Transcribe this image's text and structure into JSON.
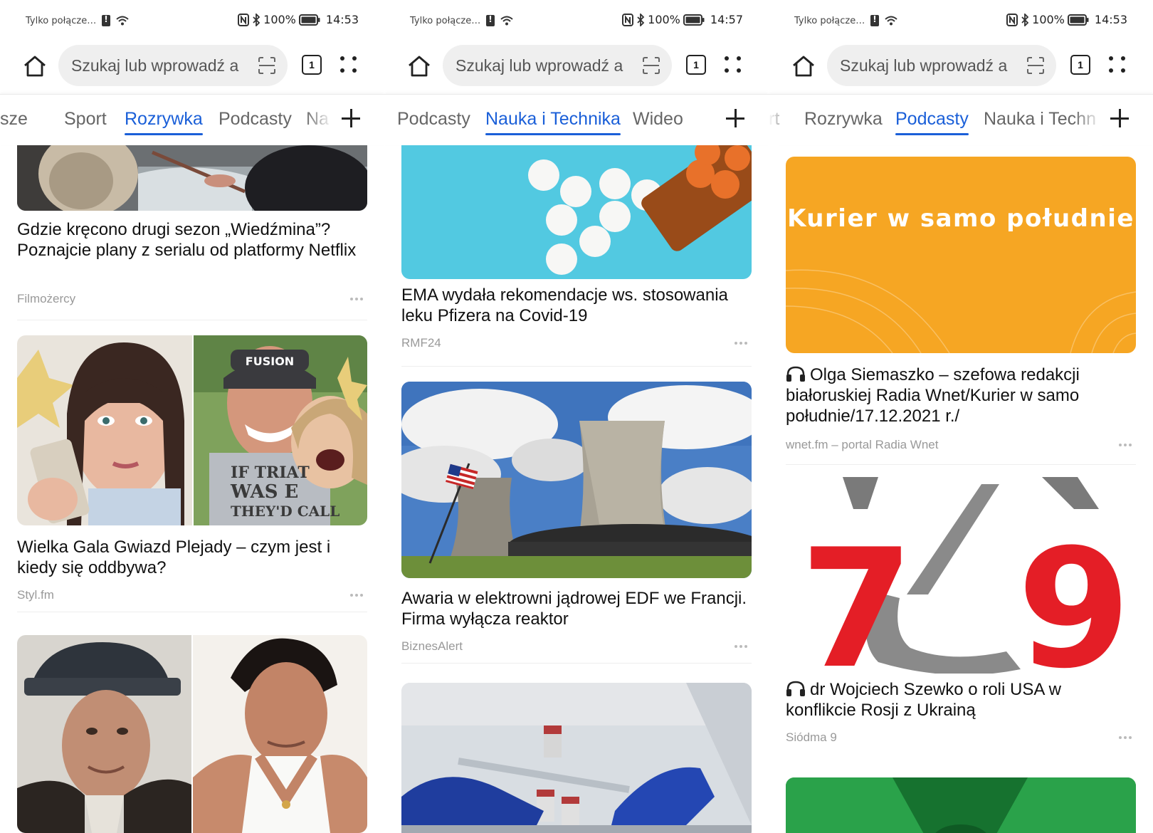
{
  "screens": [
    {
      "status": {
        "left_text": "Tylko połącze…",
        "battery": "100%",
        "time": "14:53"
      },
      "search_placeholder": "Szukaj lub wprowadź a",
      "tab_count": "1",
      "categories": [
        "wsze",
        "Sport",
        "Rozrywka",
        "Podcasty",
        "Na"
      ],
      "active_category": "Rozrywka",
      "articles": [
        {
          "title": "Gdzie kręcono drugi sezon „Wiedźmina”? Poznajcie plany z serialu od platformy Netflix",
          "source": "Filmożercy"
        },
        {
          "title": "Wielka Gala Gwiazd Plejady – czym jest i kiedy się oddbywa?",
          "source": "Styl.fm"
        }
      ],
      "image_texts": [
        "FUSION",
        "IF TRIAT",
        "WAS E",
        "THEY'D CALL"
      ]
    },
    {
      "status": {
        "left_text": "Tylko połącze…",
        "battery": "100%",
        "time": "14:57"
      },
      "search_placeholder": "Szukaj lub wprowadź a",
      "tab_count": "1",
      "categories": [
        "Podcasty",
        "Nauka i Technika",
        "Wideo"
      ],
      "active_category": "Nauka i Technika",
      "articles": [
        {
          "title": "EMA wydała rekomendacje ws. stosowania leku Pfizera na Covid-19",
          "source": "RMF24"
        },
        {
          "title": "Awaria w elektrowni jądrowej EDF we Francji. Firma wyłącza reaktor",
          "source": "BiznesAlert"
        }
      ]
    },
    {
      "status": {
        "left_text": "Tylko połącze…",
        "battery": "100%",
        "time": "14:53"
      },
      "search_placeholder": "Szukaj lub wprowadź a",
      "tab_count": "1",
      "categories": [
        "rt",
        "Rozrywka",
        "Podcasty",
        "Nauka i Techn"
      ],
      "active_category": "Podcasty",
      "articles": [
        {
          "title": "Olga Siemaszko – szefowa redakcji białoruskiej Radia Wnet/Kurier w samo południe/17.12.2021 r./",
          "source": "wnet.fm – portal Radia Wnet",
          "banner_text": "Kurier w samo południe"
        },
        {
          "title": "dr Wojciech Szewko o roli USA w konflikcie Rosji z Ukrainą",
          "source": "Siódma 9",
          "logo_left": "7",
          "logo_right": "9"
        }
      ]
    }
  ],
  "colors": {
    "accent": "#1a5fd8",
    "banner_orange": "#f6a623",
    "logo_red": "#e41e26"
  }
}
